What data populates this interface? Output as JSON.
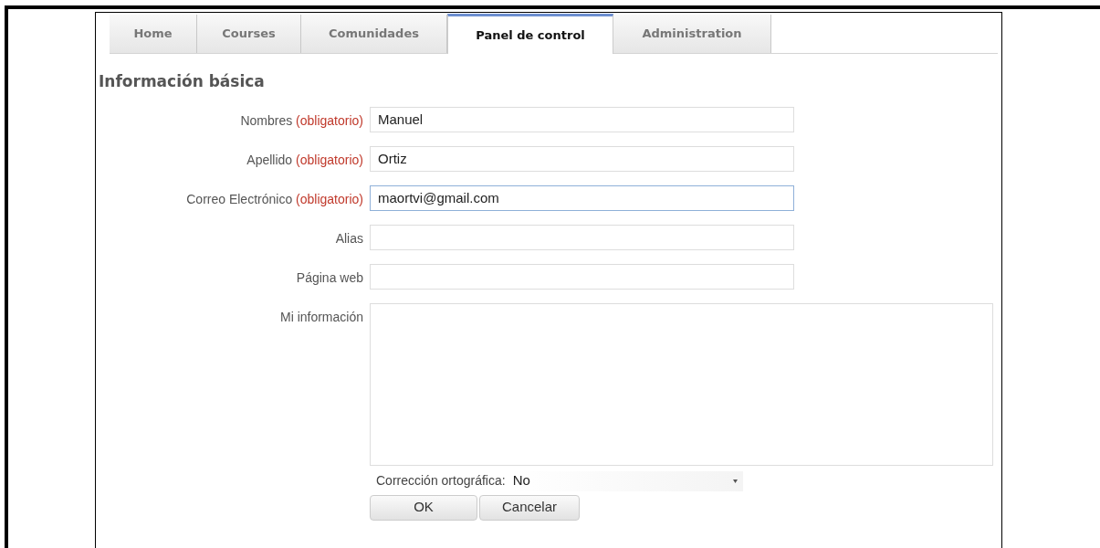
{
  "tabs": [
    {
      "label": "Home",
      "selected": false
    },
    {
      "label": "Courses",
      "selected": false
    },
    {
      "label": "Comunidades",
      "selected": false
    },
    {
      "label": "Panel de control",
      "selected": true
    },
    {
      "label": "Administration",
      "selected": false
    }
  ],
  "section_title": "Información básica",
  "fields": [
    {
      "kind": "text",
      "label": "Nombres",
      "required": "(obligatorio)",
      "value": "Manuel",
      "focused": false
    },
    {
      "kind": "text",
      "label": "Apellido",
      "required": "(obligatorio)",
      "value": "Ortiz",
      "focused": false
    },
    {
      "kind": "text",
      "label": "Correo Electrónico",
      "required": "(obligatorio)",
      "value": "maortvi@gmail.com",
      "focused": true
    },
    {
      "kind": "text",
      "label": "Alias",
      "focused": false
    },
    {
      "kind": "text",
      "label": "Página web",
      "focused": false
    },
    {
      "kind": "textarea",
      "label": "Mi información",
      "focused": false
    }
  ],
  "spellcheck": {
    "label": "Corrección ortográfica:",
    "value": "No"
  },
  "buttons": [
    "OK",
    "Cancelar"
  ]
}
